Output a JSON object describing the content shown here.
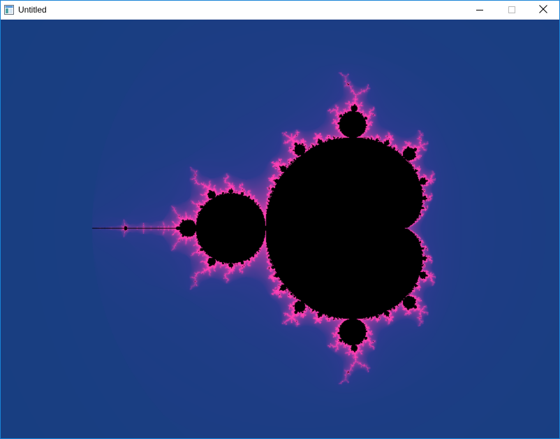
{
  "window": {
    "title": "Untitled",
    "controls": {
      "minimize_icon": "minimize-icon",
      "maximize_icon": "maximize-icon",
      "close_icon": "close-icon"
    },
    "app_icon": "window-app-icon"
  },
  "fractal": {
    "type": "Mandelbrot set",
    "colors": {
      "set": "#000000",
      "outer_background": "#143f7e",
      "inner_glow": "#2d3a8f",
      "edge": "#ff3fb4"
    }
  }
}
